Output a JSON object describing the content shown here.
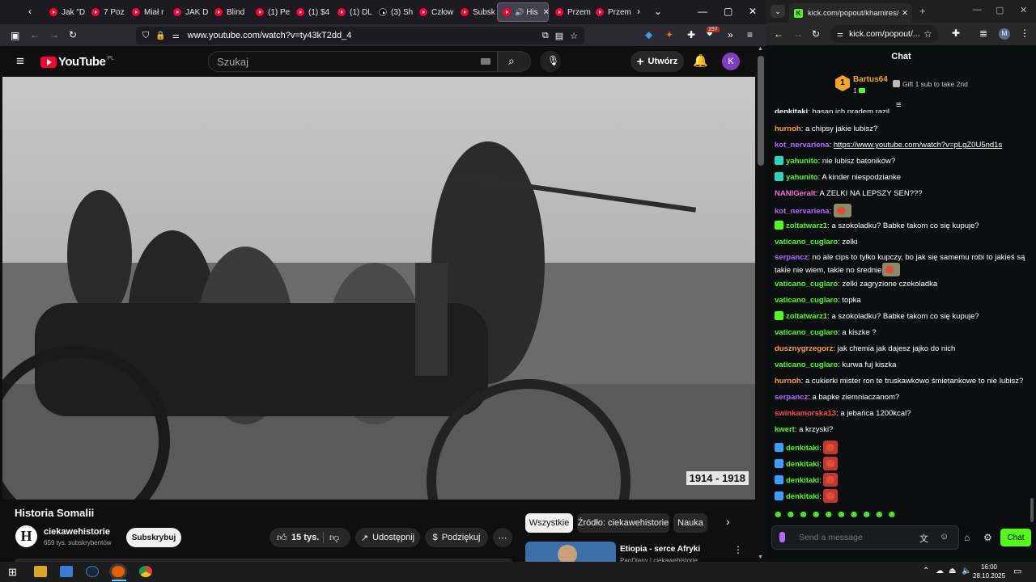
{
  "firefox": {
    "tabs": [
      {
        "label": "Jak \"D"
      },
      {
        "label": "7 Poz"
      },
      {
        "label": "Miał r"
      },
      {
        "label": "JAK D"
      },
      {
        "label": "Blind"
      },
      {
        "label": "(1) Pe"
      },
      {
        "label": "(1) $4"
      },
      {
        "label": "(1) DL"
      },
      {
        "label": "(3) Sh"
      },
      {
        "label": "Człow"
      },
      {
        "label": "Subsk"
      },
      {
        "label": "His"
      },
      {
        "label": "Przem"
      },
      {
        "label": "Przem"
      }
    ],
    "url": "www.youtube.com/watch?v=ty43kT2dd_4",
    "extension_badge": "157"
  },
  "youtube": {
    "logo": "YouTube",
    "logo_region": "PL",
    "search_placeholder": "Szukaj",
    "create_label": "Utwórz",
    "avatar_letter": "K",
    "video_caption": "1914 - 1918",
    "title": "Historia Somalii",
    "channel_name": "ciekawehistorie",
    "channel_subs": "659 tys. subskrybentów",
    "channel_logo": "H",
    "subscribe_label": "Subskrybuj",
    "likes": "15 tys.",
    "share_label": "Udostępnij",
    "thanks_label": "Podziękuj",
    "chips": [
      "Wszystkie",
      "Źródło: ciekawehistorie",
      "Nauka"
    ],
    "rec_title": "Etiopia - serce Afryki",
    "rec_channel": "PanDiany | ciekawehistorie"
  },
  "chrome": {
    "tab_title": "kick.com/popout/khamires/cha",
    "url": "kick.com/popout/...",
    "profile_letter": "M"
  },
  "kick": {
    "header": "Chat",
    "top_gifter": "Bartus64",
    "top_gifter_rank": "1",
    "top_gifter_count": "1",
    "gift_text": "Gift 1 sub to take 2nd",
    "messages": [
      {
        "user": "denkitaki",
        "color": "#ffffff",
        "text": "hasan ich pradem razil"
      },
      {
        "user": "hurnoh",
        "color": "#ff9f43",
        "text": "a chipsy jakie lubisz?"
      },
      {
        "user": "kot_nervariena",
        "color": "#b36bff",
        "text": "https://www.youtube.com/watch?v=pLgZ0U5nd1s"
      },
      {
        "user": "yahunito",
        "color": "#53fc18",
        "text": "nie lubisz batoników?"
      },
      {
        "user": "yahunito",
        "color": "#53fc18",
        "text": "A kinder niespodzianke"
      },
      {
        "user": "NANIGeralt",
        "color": "#ff6ad5",
        "text": "A ZELKI NA LEPSZY SEN???"
      },
      {
        "user": "kot_nervariena",
        "color": "#b36bff",
        "text": ""
      },
      {
        "user": "zoltatwarz1",
        "color": "#53fc18",
        "text": "a szokoladku? Babke takom co się kupuje?"
      },
      {
        "user": "vaticano_cuglaro",
        "color": "#53fc18",
        "text": "zelki"
      },
      {
        "user": "serpancz",
        "color": "#b36bff",
        "text": "no ale cips to tylko kupczy, bo jak się samemu robi to jakieś są takie nie wiem, takie no średnie"
      },
      {
        "user": "vaticano_cuglaro",
        "color": "#53fc18",
        "text": "zelki zagryzione czekoladka"
      },
      {
        "user": "vaticano_cuglaro",
        "color": "#53fc18",
        "text": "topka"
      },
      {
        "user": "zoltatwarz1",
        "color": "#53fc18",
        "text": "a szokoladku? Babke takom co się kupuje?"
      },
      {
        "user": "vaticano_cuglaro",
        "color": "#53fc18",
        "text": "a kiszke ?"
      },
      {
        "user": "dusznygrzegorz",
        "color": "#ff9f43",
        "text": "jak chemia jak dajesz jajko do nich"
      },
      {
        "user": "vaticano_cuglaro",
        "color": "#53fc18",
        "text": "kurwa fuj kiszka"
      },
      {
        "user": "hurnoh",
        "color": "#ff9f43",
        "text": "a cukierki mister ron te truskawkowo śmietankowe to nie lubisz?"
      },
      {
        "user": "serpancz",
        "color": "#b36bff",
        "text": "a bapke ziemniaczanom?"
      },
      {
        "user": "swinkamorska13",
        "color": "#ff4d4d",
        "text": "a jebańca 1200kcal?"
      },
      {
        "user": "kwert",
        "color": "#53fc18",
        "text": "a krzyski?"
      },
      {
        "user": "denkitaki",
        "color": "#53fc18",
        "text": ""
      },
      {
        "user": "denkitaki",
        "color": "#53fc18",
        "text": ""
      },
      {
        "user": "denkitaki",
        "color": "#53fc18",
        "text": ""
      },
      {
        "user": "denkitaki",
        "color": "#53fc18",
        "text": ""
      }
    ],
    "input_placeholder": "Send a message",
    "chat_button": "Chat"
  },
  "taskbar": {
    "time": "16:00",
    "date": "28.10.2025"
  },
  "colors": {
    "yt_red": "#ff0033",
    "kick_green": "#53fc18",
    "gift_gold": "#f5a623"
  }
}
